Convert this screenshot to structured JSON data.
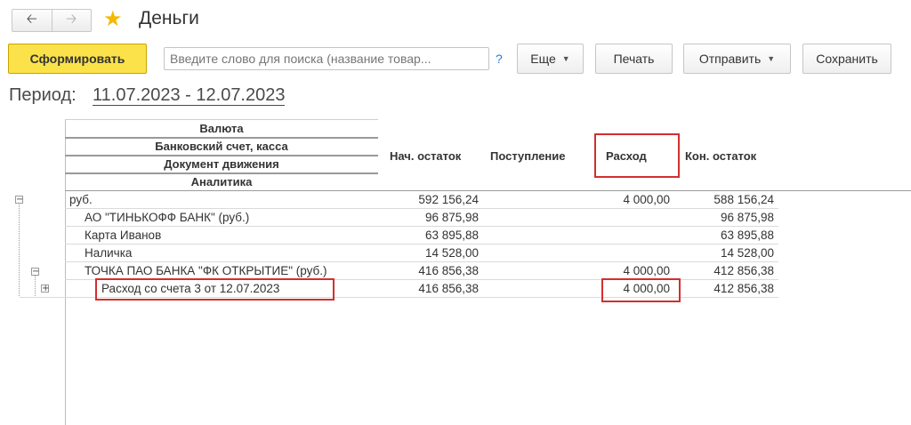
{
  "nav": {
    "back_icon": "arrow-left-icon",
    "forward_icon": "arrow-right-icon"
  },
  "title": "Деньги",
  "toolbar": {
    "generate_label": "Сформировать",
    "search_placeholder": "Введите слово для поиска (название товар...",
    "help_label": "?",
    "more_label": "Еще",
    "print_label": "Печать",
    "send_label": "Отправить",
    "save_label": "Сохранить"
  },
  "period": {
    "label": "Период:",
    "value": "11.07.2023 - 12.07.2023"
  },
  "table": {
    "group_headers": [
      "Валюта",
      "Банковский счет, касса",
      "Документ движения",
      "Аналитика"
    ],
    "columns": {
      "start": "Нач. остаток",
      "income": "Поступление",
      "expense": "Расход",
      "end": "Кон. остаток"
    },
    "rows": [
      {
        "name": "руб.",
        "start": "592 156,24",
        "income": "",
        "expense": "4 000,00",
        "end": "588 156,24"
      },
      {
        "name": "АО \"ТИНЬКОФФ БАНК\" (руб.)",
        "start": "96 875,98",
        "income": "",
        "expense": "",
        "end": "96 875,98"
      },
      {
        "name": "Карта Иванов",
        "start": "63 895,88",
        "income": "",
        "expense": "",
        "end": "63 895,88"
      },
      {
        "name": "Наличка",
        "start": "14 528,00",
        "income": "",
        "expense": "",
        "end": "14 528,00"
      },
      {
        "name": "ТОЧКА ПАО БАНКА \"ФК ОТКРЫТИЕ\" (руб.)",
        "start": "416 856,38",
        "income": "",
        "expense": "4 000,00",
        "end": "412 856,38"
      },
      {
        "name": "Расход со счета 3  от 12.07.2023",
        "start": "416 856,38",
        "income": "",
        "expense": "4 000,00",
        "end": "412 856,38"
      }
    ]
  },
  "colors": {
    "accent_yellow": "#fbe24a",
    "highlight_red": "#d32f2f",
    "star": "#f5b800"
  }
}
